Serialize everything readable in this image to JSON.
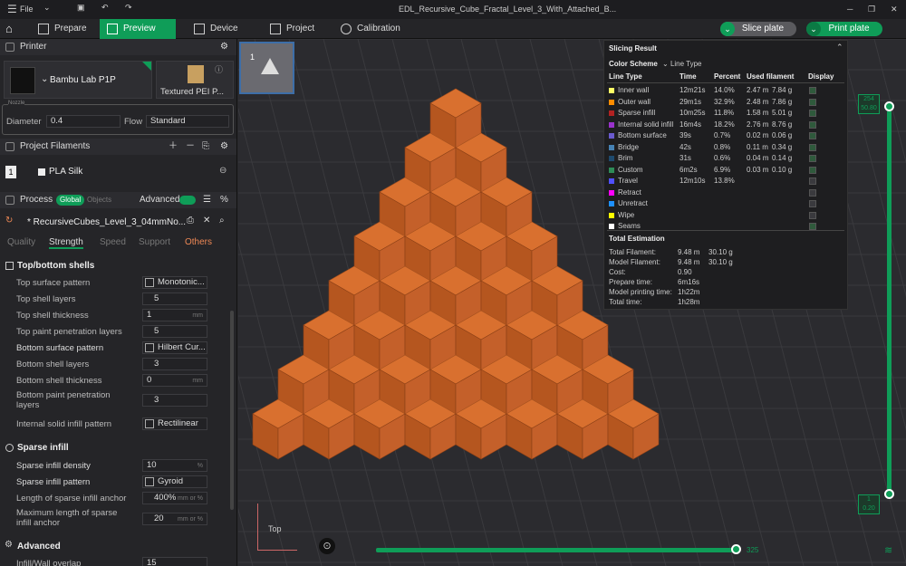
{
  "titlebar": {
    "menu": "File",
    "filename": "EDL_Recursive_Cube_Fractal_Level_3_With_Attached_B..."
  },
  "nav": {
    "tabs": [
      "Prepare",
      "Preview",
      "Device",
      "Project",
      "Calibration"
    ],
    "slice_label": "Slice plate",
    "print_label": "Print plate"
  },
  "printer": {
    "section": "Printer",
    "name": "Bambu Lab P1P",
    "plate": "Textured PEI P...",
    "nozzle_label": "Nozzle",
    "diameter_label": "Diameter",
    "diameter": "0.4",
    "flow_label": "Flow",
    "flow": "Standard"
  },
  "filaments": {
    "section": "Project Filaments",
    "index": "1",
    "name": "PLA Silk"
  },
  "process": {
    "section": "Process",
    "global": "Global",
    "objects": "Objects",
    "advanced": "Advanced",
    "preset": "* RecursiveCubes_Level_3_04mmNo...",
    "tabs": [
      "Quality",
      "Strength",
      "Speed",
      "Support",
      "Others"
    ]
  },
  "settings": {
    "group1": "Top/bottom shells",
    "top_surface_pattern_l": "Top surface pattern",
    "top_surface_pattern": "Monotonic...",
    "top_shell_layers_l": "Top shell layers",
    "top_shell_layers": "5",
    "top_shell_thickness_l": "Top shell thickness",
    "top_shell_thickness": "1",
    "top_paint_l": "Top paint penetration layers",
    "top_paint": "5",
    "bottom_surface_pattern_l": "Bottom surface pattern",
    "bottom_surface_pattern": "Hilbert Cur...",
    "bottom_shell_layers_l": "Bottom shell layers",
    "bottom_shell_layers": "3",
    "bottom_shell_thickness_l": "Bottom shell thickness",
    "bottom_shell_thickness": "0",
    "bottom_paint_l": "Bottom paint penetration layers",
    "bottom_paint": "3",
    "internal_solid_l": "Internal solid infill pattern",
    "internal_solid": "Rectilinear",
    "group2": "Sparse infill",
    "density_l": "Sparse infill density",
    "density": "10",
    "pattern_l": "Sparse infill pattern",
    "pattern": "Gyroid",
    "anchor_l": "Length of sparse infill anchor",
    "anchor": "400%",
    "maxanchor_l": "Maximum length of sparse infill anchor",
    "maxanchor": "20",
    "group3": "Advanced",
    "overlap_l": "Infill/Wall overlap",
    "overlap": "15",
    "unit_mm": "mm",
    "unit_pct": "%",
    "unit_mmpct": "mm or %"
  },
  "plate": {
    "number": "1"
  },
  "slicing": {
    "title": "Slicing Result",
    "scheme_label": "Color Scheme",
    "scheme": "Line Type",
    "headers": [
      "Line Type",
      "Time",
      "Percent",
      "Used filament",
      "Display"
    ],
    "rows": [
      {
        "name": "Inner wall",
        "time": "12m21s",
        "pct": "14.0%",
        "len": "2.47 m",
        "g": "7.84 g",
        "color": "#ffff66"
      },
      {
        "name": "Outer wall",
        "time": "29m1s",
        "pct": "32.9%",
        "len": "2.48 m",
        "g": "7.86 g",
        "color": "#ff8c00"
      },
      {
        "name": "Sparse infill",
        "time": "10m25s",
        "pct": "11.8%",
        "len": "1.58 m",
        "g": "5.01 g",
        "color": "#b22222"
      },
      {
        "name": "Internal solid infill",
        "time": "16m4s",
        "pct": "18.2%",
        "len": "2.76 m",
        "g": "8.76 g",
        "color": "#9932cc"
      },
      {
        "name": "Bottom surface",
        "time": "39s",
        "pct": "0.7%",
        "len": "0.02 m",
        "g": "0.06 g",
        "color": "#6a5acd"
      },
      {
        "name": "Bridge",
        "time": "42s",
        "pct": "0.8%",
        "len": "0.11 m",
        "g": "0.34 g",
        "color": "#4682b4"
      },
      {
        "name": "Brim",
        "time": "31s",
        "pct": "0.6%",
        "len": "0.04 m",
        "g": "0.14 g",
        "color": "#1e4a6e"
      },
      {
        "name": "Custom",
        "time": "6m2s",
        "pct": "6.9%",
        "len": "0.03 m",
        "g": "0.10 g",
        "color": "#2e8b57"
      },
      {
        "name": "Travel",
        "time": "12m10s",
        "pct": "13.8%",
        "len": "",
        "g": "",
        "color": "#5050ff"
      },
      {
        "name": "Retract",
        "time": "",
        "pct": "",
        "len": "",
        "g": "",
        "color": "#ff00ff"
      },
      {
        "name": "Unretract",
        "time": "",
        "pct": "",
        "len": "",
        "g": "",
        "color": "#1e90ff"
      },
      {
        "name": "Wipe",
        "time": "",
        "pct": "",
        "len": "",
        "g": "",
        "color": "#ffff00"
      },
      {
        "name": "Seams",
        "time": "",
        "pct": "",
        "len": "",
        "g": "",
        "color": "#ffffff"
      }
    ],
    "total_title": "Total Estimation",
    "totals": [
      {
        "k": "Total Filament:",
        "a": "9.48 m",
        "b": "30.10 g"
      },
      {
        "k": "Model Filament:",
        "a": "9.48 m",
        "b": "30.10 g"
      },
      {
        "k": "Cost:",
        "a": "0.90",
        "b": ""
      },
      {
        "k": "Prepare time:",
        "a": "6m16s",
        "b": ""
      },
      {
        "k": "Model printing time:",
        "a": "1h22m",
        "b": ""
      },
      {
        "k": "Total time:",
        "a": "1h28m",
        "b": ""
      }
    ]
  },
  "layers": {
    "top_layer": "254",
    "top_height": "50.80",
    "bottom_layer": "1",
    "bottom_height": "0.20",
    "moves": "325"
  },
  "view": {
    "label": "Top"
  }
}
